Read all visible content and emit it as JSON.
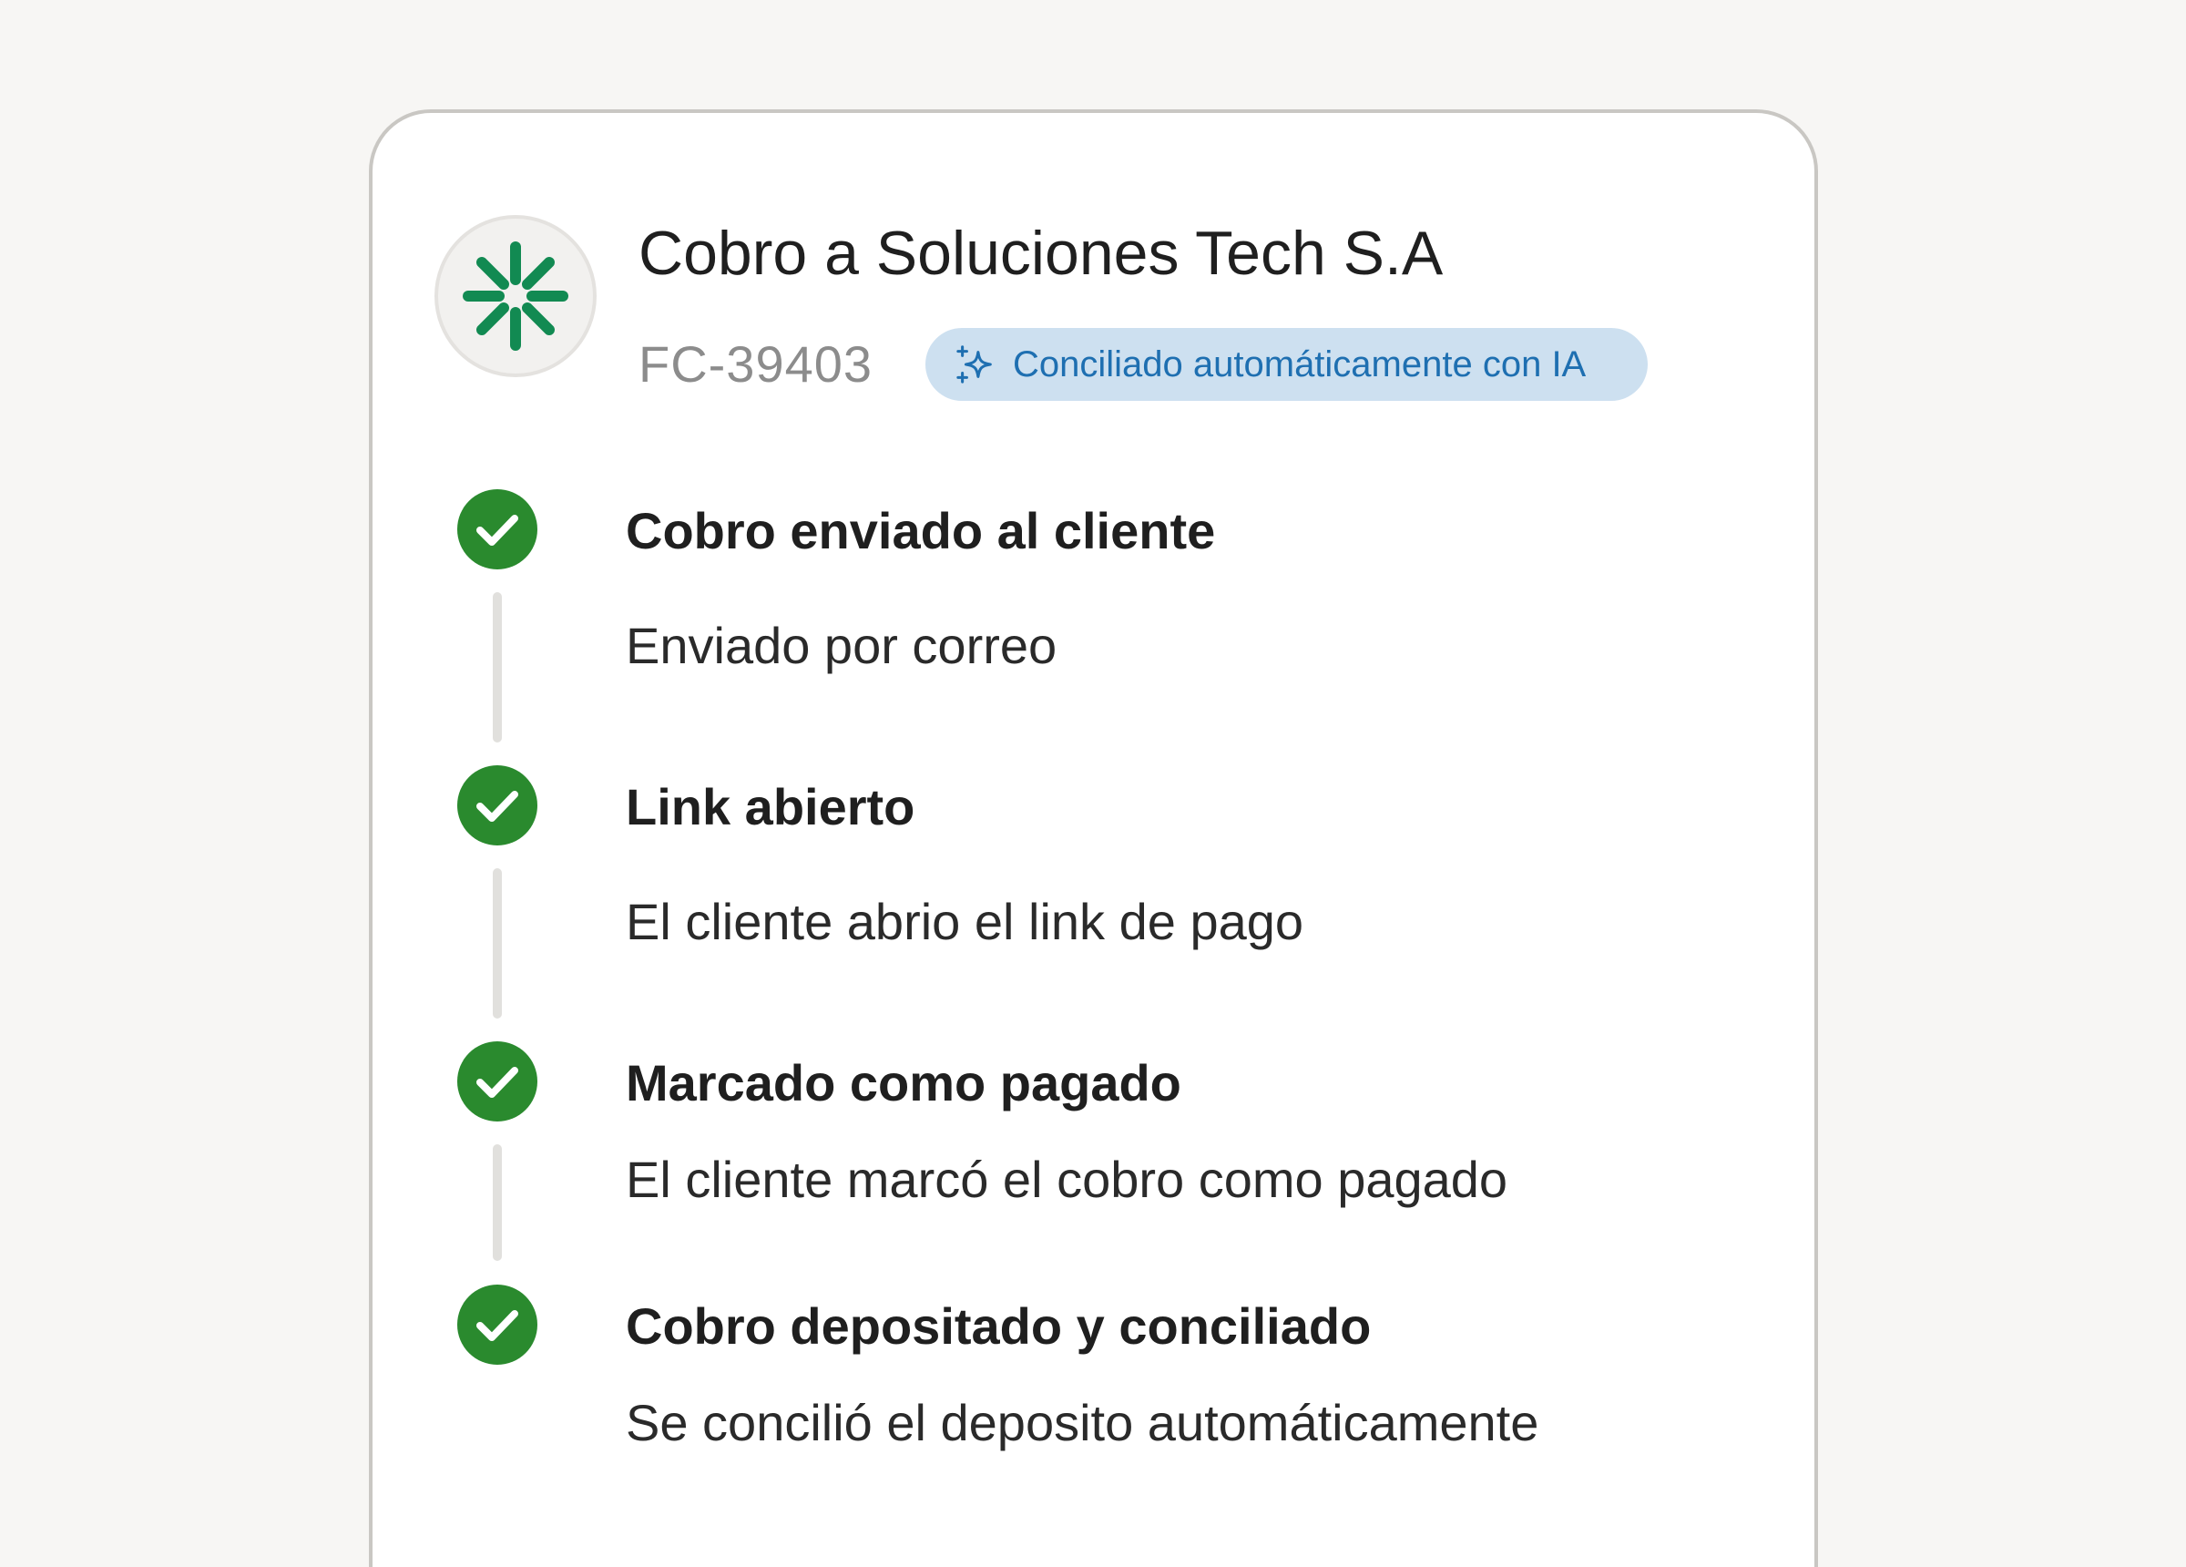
{
  "header": {
    "title": "Cobro a Soluciones Tech S.A",
    "invoice_id": "FC-39403",
    "ai_badge": "Conciliado automáticamente con IA",
    "avatar_icon": "spinner-burst-icon",
    "badge_icon": "sparkle-icon"
  },
  "colors": {
    "brand_green": "#128a52",
    "check_green": "#2a8a2e",
    "badge_bg": "#cde0f0",
    "badge_text": "#1e6fb1"
  },
  "timeline": [
    {
      "title": "Cobro enviado al cliente",
      "description": "Enviado por correo",
      "status": "completed"
    },
    {
      "title": "Link abierto",
      "description": "El cliente abrio el link de pago",
      "status": "completed"
    },
    {
      "title": "Marcado como pagado",
      "description": "El cliente marcó el cobro como pagado",
      "status": "completed"
    },
    {
      "title": "Cobro depositado y conciliado",
      "description": "Se concilió el deposito automáticamente",
      "status": "completed"
    }
  ]
}
